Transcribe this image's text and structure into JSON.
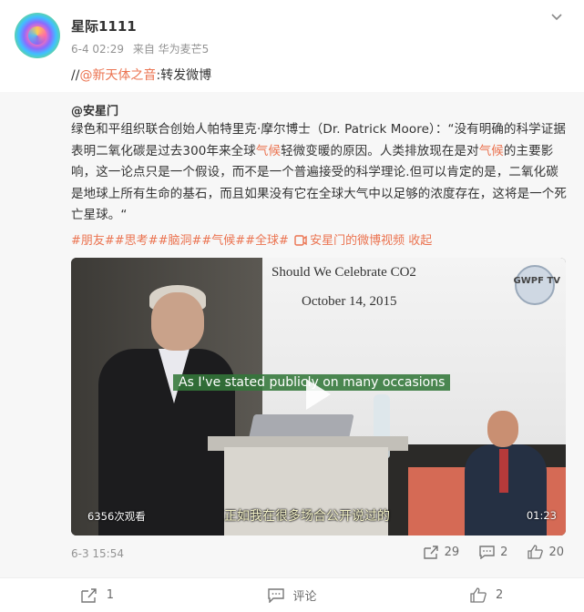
{
  "post": {
    "username": "星际1111",
    "time": "6-4 02:29",
    "source": "来自 华为麦芒5",
    "repost_prefix": "//",
    "repost_mention": "@新天体之音",
    "repost_suffix": ":转发微博"
  },
  "quoted": {
    "author": "@安星门",
    "text_parts": [
      "绿色和平组织联合创始人帕特里克·摩尔博士（Dr. Patrick Moore）：“没有明确的科学证据表明二氧化碳是过去300年来全球",
      "气候",
      "轻微变暖的原因。人类排放现在是对",
      "气候",
      "的主要影响，这一论点只是一个假设，而不是一个普遍接受的科学理论.但可以肯定的是，二氧化碳是地球上所有生命的基石，而且如果没有它在全球大气中以足够的浓度存在，这将是一个死亡星球。“"
    ],
    "tags": "#朋友##思考##脑洞##气候##全球#",
    "video_link": "安星门的微博视频",
    "collapse": "收起",
    "date": "6-3 15:54",
    "reposts": "29",
    "comments": "2",
    "likes": "20"
  },
  "video": {
    "slide_title": "Should We Celebrate CO2",
    "slide_date": "October 14, 2015",
    "logo": "GWPF TV",
    "subtitle_en": "As I've stated publicly on many occasions",
    "subtitle_cn": "正如我在很多场合公开说过的",
    "views": "6356次观看",
    "duration": "01:23"
  },
  "actions": {
    "repost_count": "1",
    "comment_label": "评论",
    "like_count": "2"
  },
  "colors": {
    "accent": "#eb7350",
    "muted": "#939393",
    "quote_bg": "#f7f7f7"
  }
}
